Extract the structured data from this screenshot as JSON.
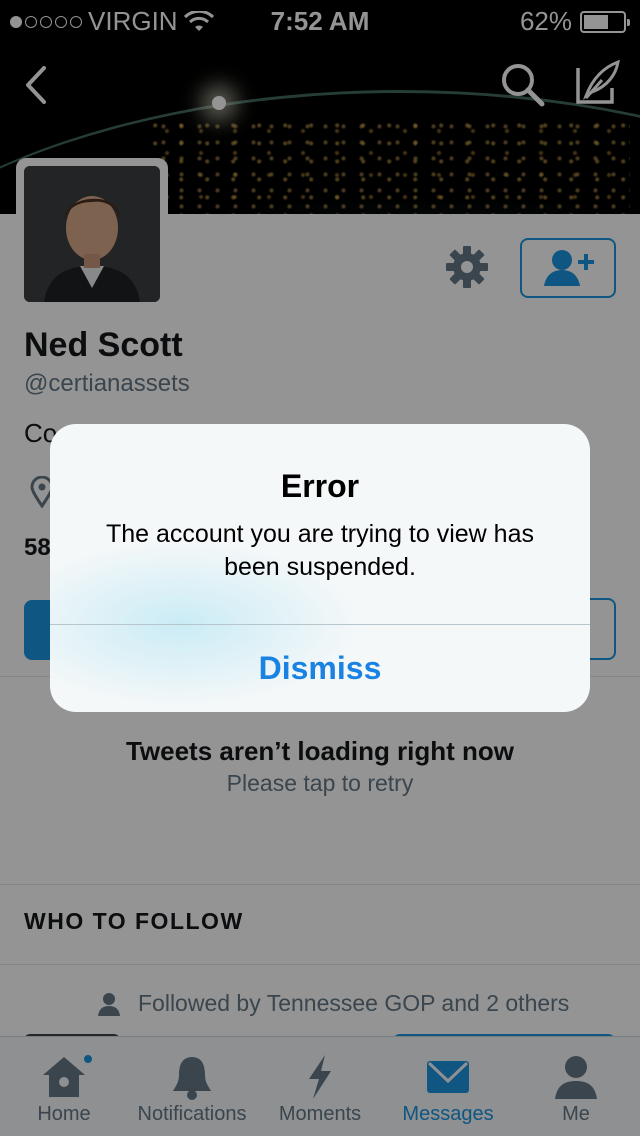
{
  "status_bar": {
    "carrier": "VIRGIN",
    "time": "7:52 AM",
    "battery": "62%",
    "battery_level": 0.62,
    "signal_dots_filled": 1
  },
  "nav": {
    "back_icon": "chevron-left-icon",
    "search_icon": "search-icon",
    "compose_icon": "compose-feather-icon"
  },
  "profile": {
    "name": "Ned Scott",
    "handle": "@certianassets",
    "bio_fragment": "Co",
    "count_fragment": "58"
  },
  "tweets": {
    "title": "Tweets aren’t loading right now",
    "subtitle": "Please tap to retry"
  },
  "who_to_follow": {
    "heading": "WHO TO FOLLOW",
    "followed_by": "Followed by Tennessee GOP and 2 others"
  },
  "tabbar": {
    "items": [
      {
        "label": "Home",
        "icon": "home-icon",
        "active": false
      },
      {
        "label": "Notifications",
        "icon": "bell-icon",
        "active": false
      },
      {
        "label": "Moments",
        "icon": "lightning-icon",
        "active": false
      },
      {
        "label": "Messages",
        "icon": "envelope-icon",
        "active": true
      },
      {
        "label": "Me",
        "icon": "person-icon",
        "active": false
      }
    ]
  },
  "alert": {
    "title": "Error",
    "message": "The account you are trying to view has been suspended.",
    "dismiss_label": "Dismiss"
  },
  "colors": {
    "accent": "#1b95e0",
    "alert_button": "#1a82e2",
    "muted_text": "#657786"
  }
}
